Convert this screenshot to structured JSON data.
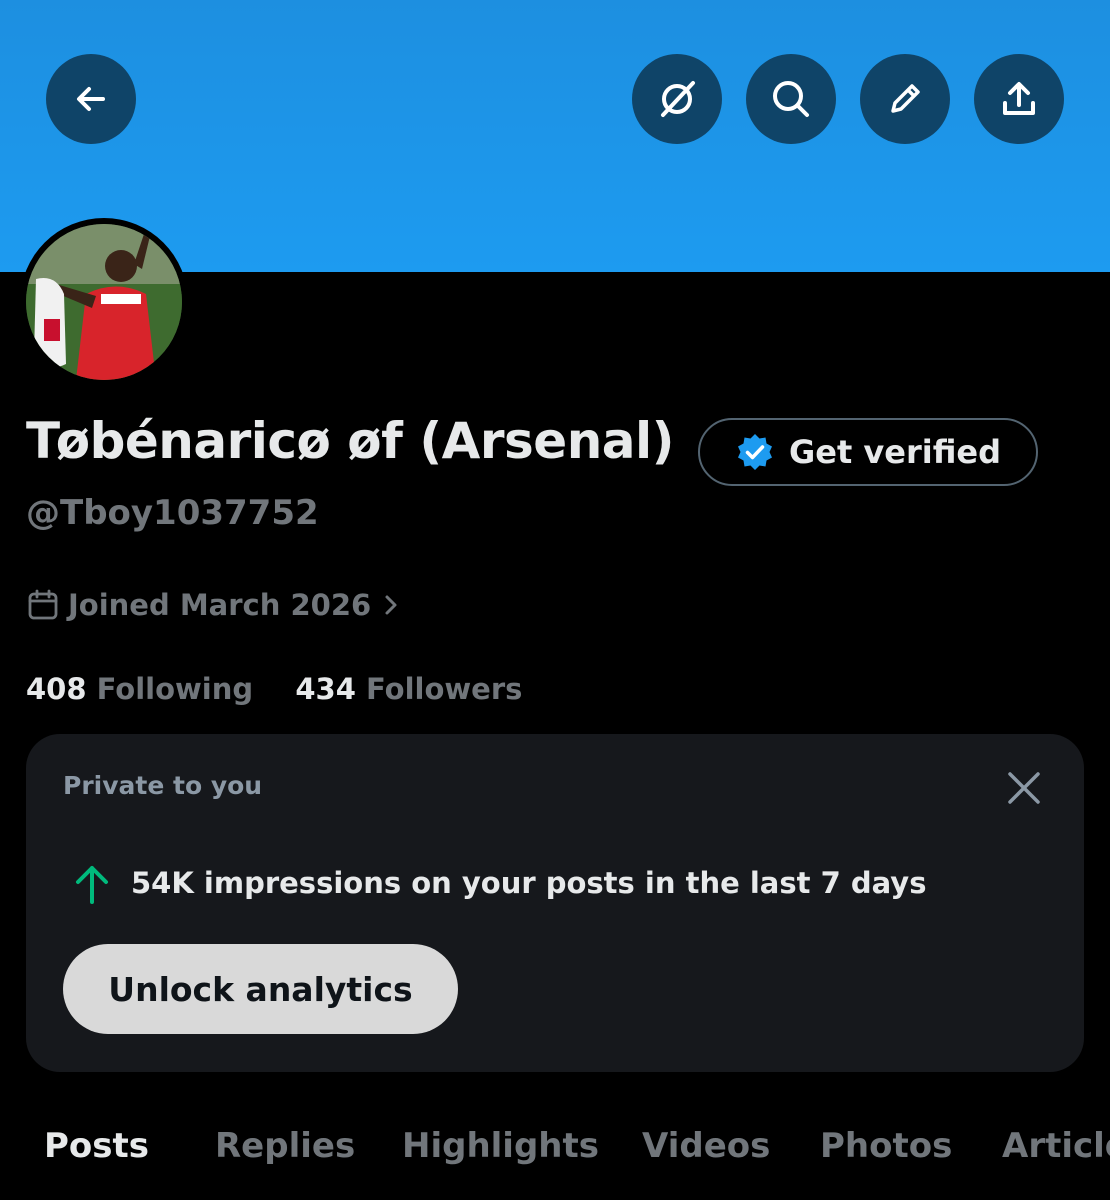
{
  "profile": {
    "name": "Tøbénaricø øf (Arsenal)",
    "handle": "@Tboy1037752",
    "joined": "Joined March 2026",
    "following_count": "408",
    "following_label": "Following",
    "followers_count": "434",
    "followers_label": "Followers",
    "verify_label": "Get verified"
  },
  "header": {
    "icons": [
      "back-arrow-icon",
      "grok-icon",
      "search-icon",
      "edit-pencil-icon",
      "share-icon"
    ]
  },
  "insight_card": {
    "private_label": "Private to you",
    "impressions_text": "54K impressions on your posts in the last 7 days",
    "unlock_label": "Unlock analytics"
  },
  "tabs": [
    {
      "label": "Posts",
      "active": true
    },
    {
      "label": "Replies",
      "active": false
    },
    {
      "label": "Highlights",
      "active": false
    },
    {
      "label": "Videos",
      "active": false
    },
    {
      "label": "Photos",
      "active": false
    },
    {
      "label": "Articles",
      "active": false
    }
  ],
  "colors": {
    "banner": "#1d9bf0",
    "background": "#000000",
    "card": "#16181c",
    "muted_text": "#71767b",
    "verified_badge": "#1d9bf0",
    "up_arrow": "#00ba7c"
  }
}
